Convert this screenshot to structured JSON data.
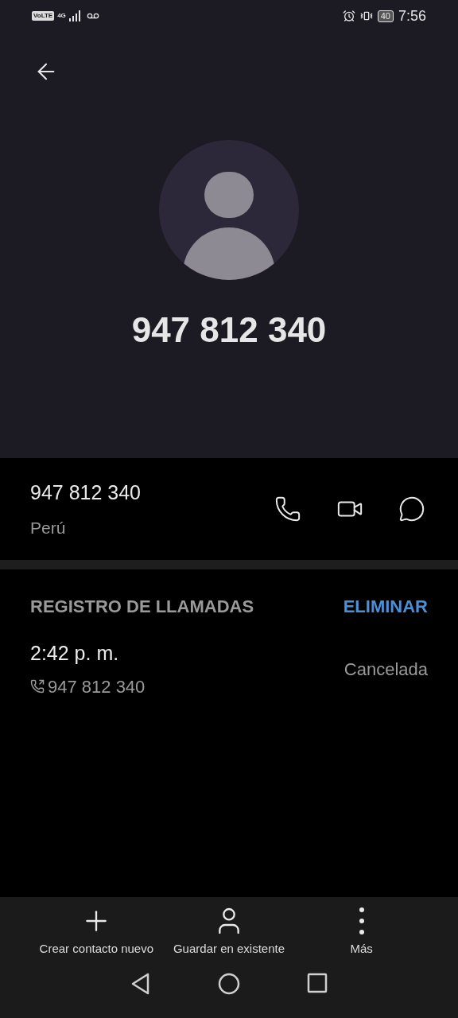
{
  "status_bar": {
    "volte": "VoLTE",
    "network": "4G",
    "battery": "40",
    "time": "7:56"
  },
  "header": {
    "title": "947 812 340"
  },
  "number_row": {
    "number": "947 812 340",
    "location": "Perú",
    "actions": [
      {
        "kind": "call"
      },
      {
        "kind": "video"
      },
      {
        "kind": "message"
      }
    ]
  },
  "call_log": {
    "heading": "REGISTRO DE LLAMADAS",
    "delete_label": "ELIMINAR",
    "entries": [
      {
        "time": "2:42 p. m.",
        "kind": "outgoing",
        "number": "947 812 340",
        "status": "Cancelada"
      }
    ]
  },
  "toolbar": [
    {
      "kind": "add",
      "label": "Crear contacto nuevo"
    },
    {
      "kind": "person",
      "label": "Guardar en existente"
    },
    {
      "kind": "more",
      "label": "Más"
    }
  ]
}
